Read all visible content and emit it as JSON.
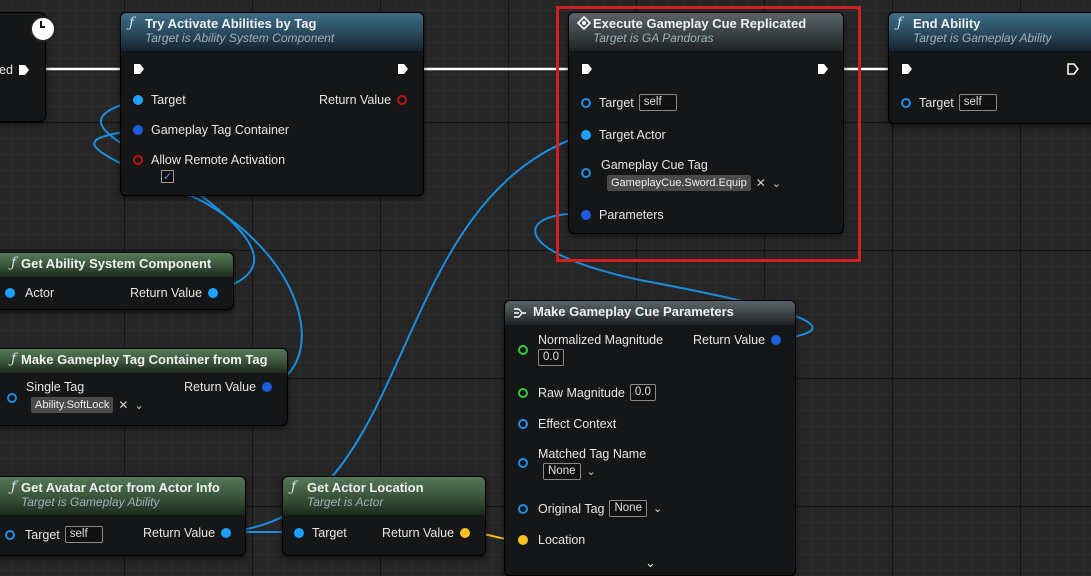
{
  "nodes": {
    "try_activate": {
      "title": "Try Activate Abilities by Tag",
      "subtitle": "Target is Ability System Component",
      "pins": {
        "target": "Target",
        "container": "Gameplay Tag Container",
        "allow_remote": "Allow Remote Activation",
        "return_value": "Return Value"
      },
      "allow_remote_checked": true
    },
    "execute_cue": {
      "title": "Execute Gameplay Cue Replicated",
      "subtitle": "Target is GA Pandoras",
      "pins": {
        "target": "Target",
        "target_default": "self",
        "target_actor": "Target Actor",
        "cue_tag": "Gameplay Cue Tag",
        "cue_tag_value": "GameplayCue.Sword.Equip",
        "parameters": "Parameters"
      }
    },
    "end_ability": {
      "title": "End Ability",
      "subtitle": "Target is Gameplay Ability",
      "pins": {
        "target": "Target",
        "target_default": "self"
      }
    },
    "left_event": {
      "exec_label_fragment": "ed"
    },
    "get_asc": {
      "title": "Get Ability System Component",
      "pins": {
        "actor": "Actor",
        "return_value": "Return Value"
      }
    },
    "make_tag_container": {
      "title": "Make Gameplay Tag Container from Tag",
      "pins": {
        "single_tag": "Single Tag",
        "single_tag_value": "Ability.SoftLock",
        "return_value": "Return Value"
      }
    },
    "get_avatar": {
      "title": "Get Avatar Actor from Actor Info",
      "subtitle": "Target is Gameplay Ability",
      "pins": {
        "target": "Target",
        "target_default": "self",
        "return_value": "Return Value"
      }
    },
    "get_actor_location": {
      "title": "Get Actor Location",
      "subtitle": "Target is Actor",
      "pins": {
        "target": "Target",
        "return_value": "Return Value"
      }
    },
    "make_cue_params": {
      "title": "Make Gameplay Cue Parameters",
      "pins": {
        "normalized_magnitude": "Normalized Magnitude",
        "normalized_magnitude_value": "0.0",
        "raw_magnitude": "Raw Magnitude",
        "raw_magnitude_value": "0.0",
        "effect_context": "Effect Context",
        "matched_tag_name": "Matched Tag Name",
        "matched_tag_value": "None",
        "original_tag": "Original Tag",
        "original_tag_value": "None",
        "location": "Location",
        "return_value": "Return Value"
      }
    }
  },
  "icons": {
    "function": "ƒ",
    "remove": "✕",
    "dropdown": "⌄",
    "checkmark": "✓"
  },
  "colors": {
    "exec_wire": "#ffffff",
    "object_wire": "#1a8fe0",
    "vector_wire": "#f7c21d",
    "highlight": "#d11f24"
  }
}
